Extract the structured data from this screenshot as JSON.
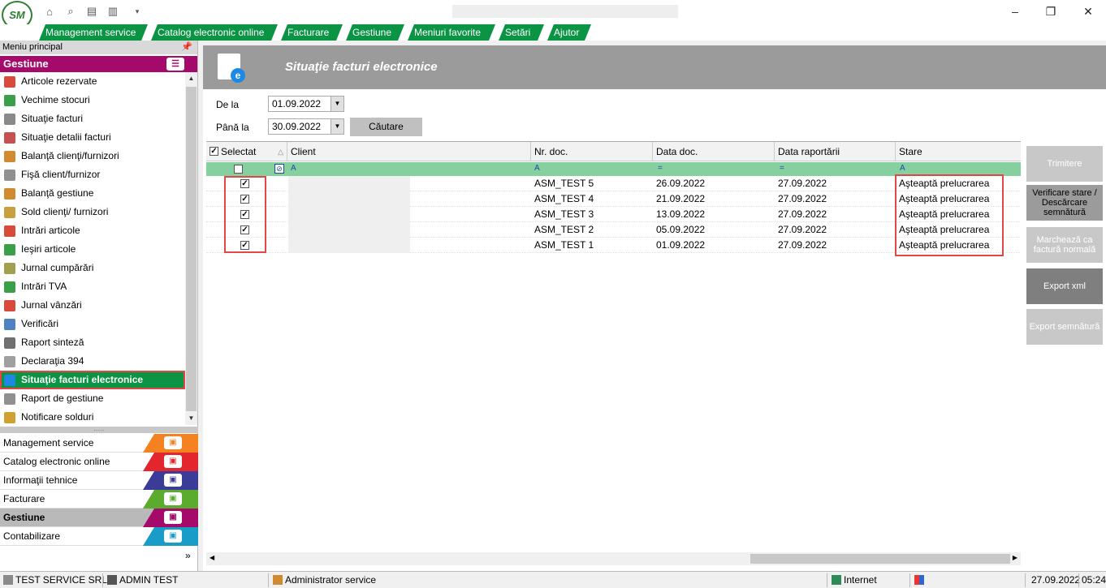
{
  "menubar": {
    "tabs": [
      "Management service",
      "Catalog electronic online",
      "Facturare",
      "Gestiune",
      "Meniuri favorite",
      "Setări",
      "Ajutor"
    ]
  },
  "left_panel": {
    "header": "Meniu principal",
    "section_title": "Gestiune",
    "items": [
      {
        "label": "Articole rezervate",
        "icon": "reserved-items-icon",
        "color": "#d84a3a"
      },
      {
        "label": "Vechime stocuri",
        "icon": "stock-age-icon",
        "color": "#3aa048"
      },
      {
        "label": "Situaţie facturi",
        "icon": "invoices-icon",
        "color": "#8a8a8a"
      },
      {
        "label": "Situaţie detalii facturi",
        "icon": "invoice-details-icon",
        "color": "#c85050"
      },
      {
        "label": "Balanţă clienţi/furnizori",
        "icon": "balance-icon",
        "color": "#d08a30"
      },
      {
        "label": "Fişă client/furnizor",
        "icon": "client-sheet-icon",
        "color": "#909090"
      },
      {
        "label": "Balanţă gestiune",
        "icon": "stock-balance-icon",
        "color": "#d08a30"
      },
      {
        "label": "Sold clienţi/ furnizori",
        "icon": "client-sold-icon",
        "color": "#c8a040"
      },
      {
        "label": "Intrări articole",
        "icon": "items-in-icon",
        "color": "#d84a3a"
      },
      {
        "label": "Ieşiri articole",
        "icon": "items-out-icon",
        "color": "#3aa048"
      },
      {
        "label": "Jurnal cumpărări",
        "icon": "purchase-journal-icon",
        "color": "#a0a050"
      },
      {
        "label": "Intrări TVA",
        "icon": "vat-in-icon",
        "color": "#3aa048"
      },
      {
        "label": "Jurnal vânzări",
        "icon": "sales-journal-icon",
        "color": "#d84a3a"
      },
      {
        "label": "Verificări",
        "icon": "checks-icon",
        "color": "#5080c0"
      },
      {
        "label": "Raport sinteză",
        "icon": "summary-report-icon",
        "color": "#707070"
      },
      {
        "label": "Declaraţia 394",
        "icon": "declaration-icon",
        "color": "#a0a0a0"
      },
      {
        "label": "Situaţie facturi electronice",
        "icon": "e-invoice-icon",
        "color": "#1e88e5",
        "active": true
      },
      {
        "label": "Raport de gestiune",
        "icon": "management-report-icon",
        "color": "#909090"
      },
      {
        "label": "Notificare solduri",
        "icon": "balance-notify-icon",
        "color": "#d0a030"
      }
    ],
    "modules": [
      {
        "label": "Management service",
        "color": "#f58220",
        "icon": "management-icon"
      },
      {
        "label": "Catalog electronic online",
        "color": "#e3262e",
        "icon": "catalog-icon"
      },
      {
        "label": "Informaţii tehnice",
        "color": "#3b3b98",
        "icon": "tech-info-icon"
      },
      {
        "label": "Facturare",
        "color": "#5aab2e",
        "icon": "invoicing-icon"
      },
      {
        "label": "Gestiune",
        "color": "#a50a6a",
        "icon": "stock-icon",
        "current": true
      },
      {
        "label": "Contabilizare",
        "color": "#1a9cc8",
        "icon": "accounting-icon"
      }
    ]
  },
  "page": {
    "title": "Situaţie facturi electronice"
  },
  "filters": {
    "from_label": "De la",
    "from_value": "01.09.2022",
    "to_label": "Până la",
    "to_value": "30.09.2022",
    "search_label": "Căutare"
  },
  "grid": {
    "columns": [
      "Selectat",
      "Client",
      "Nr. doc.",
      "Data doc.",
      "Data raportării",
      "Stare"
    ],
    "rows": [
      {
        "selected": true,
        "client": "",
        "nr_doc": "ASM_TEST 5",
        "data_doc": "26.09.2022",
        "data_raport": "27.09.2022",
        "stare": "Aşteaptă prelucrarea"
      },
      {
        "selected": true,
        "client": "",
        "nr_doc": "ASM_TEST 4",
        "data_doc": "21.09.2022",
        "data_raport": "27.09.2022",
        "stare": "Aşteaptă prelucrarea"
      },
      {
        "selected": true,
        "client": "",
        "nr_doc": "ASM_TEST 3",
        "data_doc": "13.09.2022",
        "data_raport": "27.09.2022",
        "stare": "Aşteaptă prelucrarea"
      },
      {
        "selected": true,
        "client": "",
        "nr_doc": "ASM_TEST 2",
        "data_doc": "05.09.2022",
        "data_raport": "27.09.2022",
        "stare": "Aşteaptă prelucrarea"
      },
      {
        "selected": true,
        "client": "",
        "nr_doc": "ASM_TEST 1",
        "data_doc": "01.09.2022",
        "data_raport": "27.09.2022",
        "stare": "Aşteaptă prelucrarea"
      }
    ]
  },
  "actions": [
    {
      "label": "Trimitere",
      "enabled": false
    },
    {
      "label": "Verificare stare / Descărcare semnătură",
      "enabled": true
    },
    {
      "label": "Marchează ca factură normală",
      "enabled": false
    },
    {
      "label": "Export xml",
      "enabled": true
    },
    {
      "label": "Export semnătură",
      "enabled": false
    }
  ],
  "status": {
    "company": "TEST SERVICE SRL",
    "user": "ADMIN TEST",
    "role": "Administrator service",
    "zone": "Internet",
    "date": "27.09.2022",
    "time": "05:24"
  }
}
